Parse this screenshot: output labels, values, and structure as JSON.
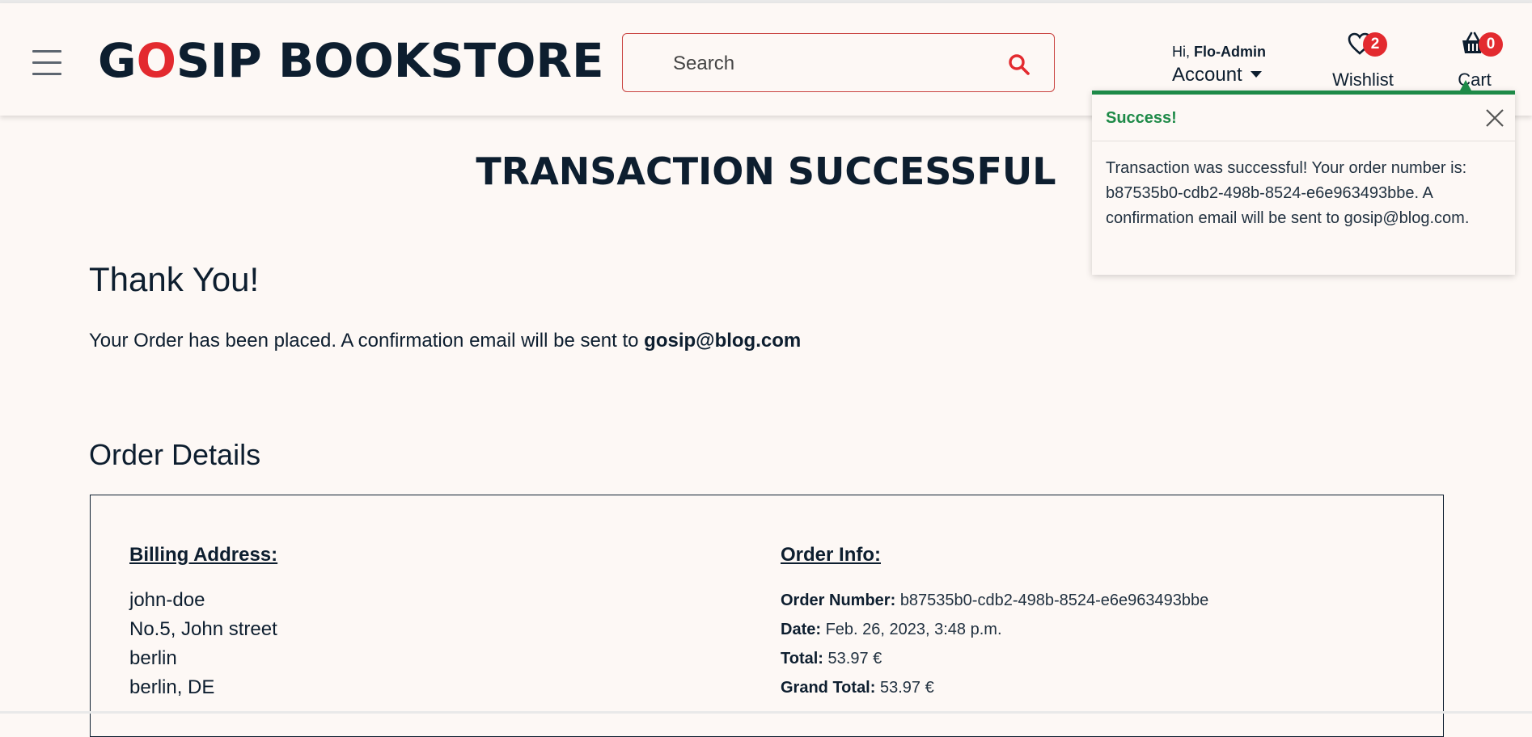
{
  "header": {
    "logo": {
      "part1": "G",
      "part2": "O",
      "part3": "SIP BOOKSTORE"
    },
    "search": {
      "placeholder": "Search"
    },
    "account": {
      "greeting": "Hi,",
      "username": "Flo-Admin",
      "label": "Account"
    },
    "wishlist": {
      "label": "Wishlist",
      "count": "2"
    },
    "cart": {
      "label": "Cart",
      "count": "0"
    }
  },
  "toast": {
    "title": "Success!",
    "message": "Transaction was successful! Your order number is: b87535b0-cdb2-498b-8524-e6e963493bbe. A confirmation email will be sent to gosip@blog.com."
  },
  "main": {
    "title": "TRANSACTION SUCCESSFUL",
    "thanks": "Thank You!",
    "placed_text": "Your Order has been placed. A confirmation email will be sent to",
    "email": "gosip@blog.com",
    "order_details_title": "Order Details",
    "billing": {
      "heading": "Billing Address:",
      "lines": [
        "john-doe",
        "No.5, John street",
        "berlin",
        "berlin, DE"
      ]
    },
    "order_info": {
      "heading": "Order Info:",
      "rows": [
        {
          "label": "Order Number:",
          "value": "b87535b0-cdb2-498b-8524-e6e963493bbe"
        },
        {
          "label": "Date:",
          "value": "Feb. 26, 2023, 3:48 p.m."
        },
        {
          "label": "Total:",
          "value": "53.97 €"
        },
        {
          "label": "Grand Total:",
          "value": "53.97 €"
        }
      ]
    }
  },
  "colors": {
    "accent_red": "#e32a2f",
    "success_green": "#1e8a48",
    "navy": "#0d1e2f",
    "background": "#fdf8f5"
  }
}
